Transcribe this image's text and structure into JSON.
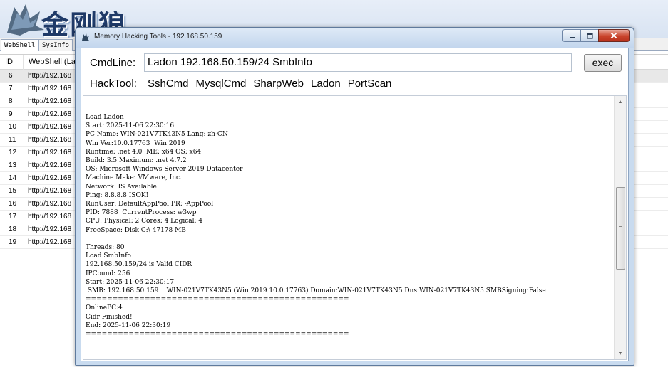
{
  "background_app": {
    "logo_text": "金刚狼",
    "tabs": [
      "WebShell",
      "SysInfo"
    ],
    "table": {
      "columns": [
        "ID",
        "WebShell (Lay"
      ],
      "rows": [
        {
          "id": "6",
          "url": "http://192.168"
        },
        {
          "id": "7",
          "url": "http://192.168"
        },
        {
          "id": "8",
          "url": "http://192.168"
        },
        {
          "id": "9",
          "url": "http://192.168"
        },
        {
          "id": "10",
          "url": "http://192.168"
        },
        {
          "id": "11",
          "url": "http://192.168"
        },
        {
          "id": "12",
          "url": "http://192.168"
        },
        {
          "id": "13",
          "url": "http://192.168"
        },
        {
          "id": "14",
          "url": "http://192.168"
        },
        {
          "id": "15",
          "url": "http://192.168"
        },
        {
          "id": "16",
          "url": "http://192.168"
        },
        {
          "id": "17",
          "url": "http://192.168"
        },
        {
          "id": "18",
          "url": "http://192.168"
        },
        {
          "id": "19",
          "url": "http://192.168"
        }
      ]
    }
  },
  "dialog": {
    "title": "Memory Hacking Tools - 192.168.50.159",
    "cmdline_label": "CmdLine:",
    "cmdline_value": "Ladon 192.168.50.159/24 SmbInfo",
    "exec_label": "exec",
    "hacktool_label": "HackTool:",
    "hacktools": [
      "SshCmd",
      "MysqlCmd",
      "SharpWeb",
      "Ladon",
      "PortScan"
    ],
    "output_lines": [
      "Load Ladon",
      "Start: 2025-11-06 22:30:16",
      "PC Name: WIN-021V7TK43N5 Lang: zh-CN",
      "Win Ver:10.0.17763  Win 2019",
      "Runtime: .net 4.0  ME: x64 OS: x64",
      "Build: 3.5 Maximum: .net 4.7.2",
      "OS: Microsoft Windows Server 2019 Datacenter",
      "Machine Make: VMware, Inc.",
      "Network: IS Available",
      "Ping: 8.8.8.8 ISOK!",
      "RunUser: DefaultAppPool PR: -AppPool",
      "PID: 7888  CurrentProcess: w3wp",
      "CPU: Physical: 2 Cores: 4 Logical: 4",
      "FreeSpace: Disk C:\\ 47178 MB",
      "",
      "Threads: 80",
      "Load SmbInfo",
      "192.168.50.159/24 is Valid CIDR",
      "IPCound: 256",
      "Start: 2025-11-06 22:30:17",
      " SMB: 192.168.50.159    WIN-021V7TK43N5 (Win 2019 10.0.17763) Domain:WIN-021V7TK43N5 Dns:WIN-021V7TK43N5 SMBSigning:False",
      "=================================================",
      "OnlinePC:4",
      "Cidr Finished!",
      "End: 2025-11-06 22:30:19",
      "================================================="
    ]
  }
}
